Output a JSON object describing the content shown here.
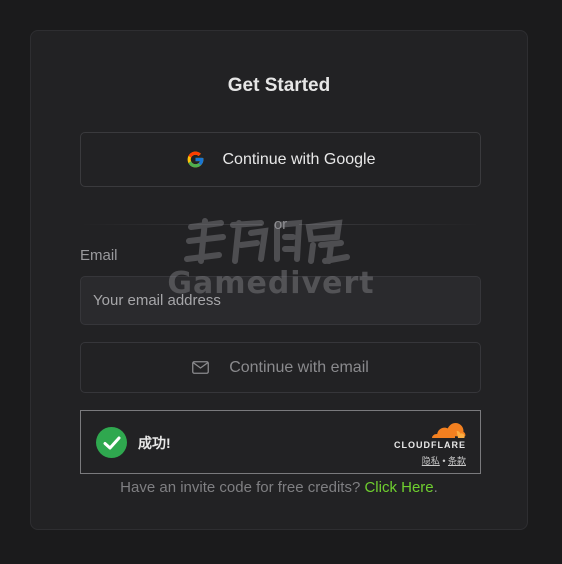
{
  "card": {
    "title": "Get Started"
  },
  "google_button": {
    "label": "Continue with Google",
    "icon": "google-icon"
  },
  "divider": {
    "text": "or"
  },
  "email": {
    "label": "Email",
    "placeholder": "Your email address",
    "value": ""
  },
  "email_button": {
    "label": "Continue with email",
    "icon": "mail-icon"
  },
  "turnstile": {
    "status": "成功!",
    "brand": "CLOUDFLARE",
    "privacy": "隐私",
    "separator": "•",
    "terms": "条款",
    "brand_color": "#f38020",
    "success_color": "#2fa84f"
  },
  "invite": {
    "text": "Have an invite code for free credits? ",
    "link": "Click Here",
    "suffix": ".",
    "link_color": "#6fcf2f"
  },
  "watermark": {
    "top": "",
    "bottom": "Gamedivert"
  }
}
